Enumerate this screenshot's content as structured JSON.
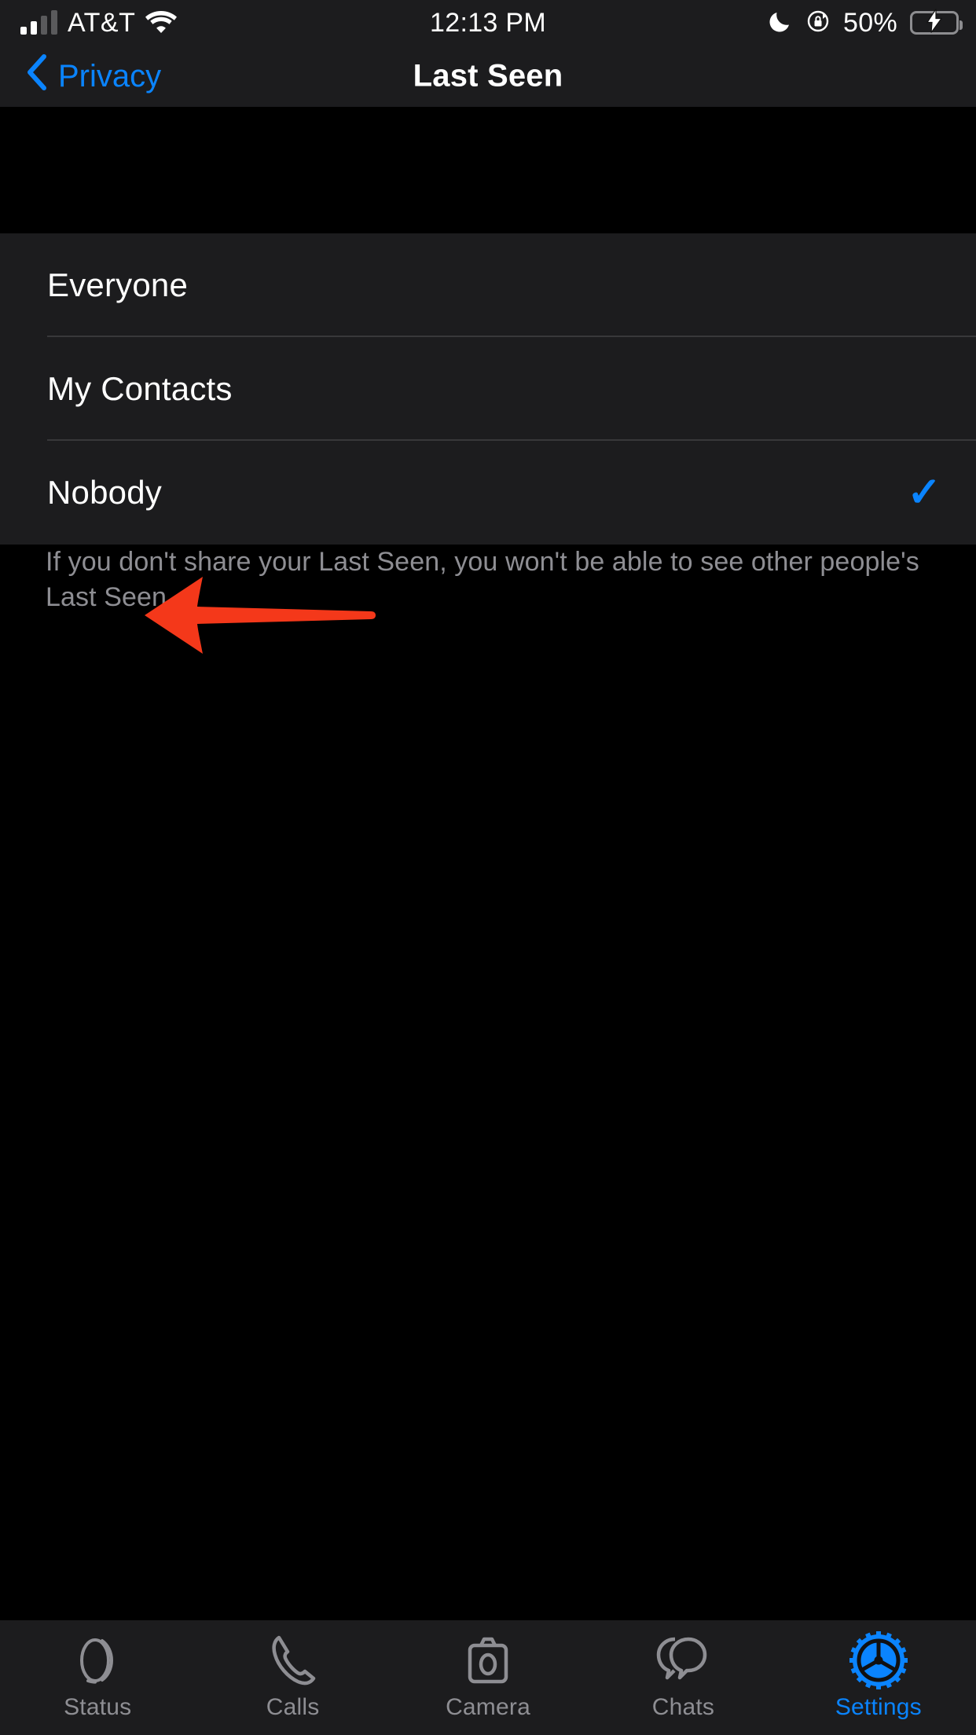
{
  "status_bar": {
    "carrier": "AT&T",
    "signal_bars_filled": 2,
    "signal_bars_total": 4,
    "wifi": "wifi-icon",
    "time": "12:13 PM",
    "dnd": "moon-icon",
    "rotation_lock": "rotation-lock-icon",
    "battery_percent": "50%",
    "battery_level": 50,
    "charging": true,
    "battery_color": "#2fd158"
  },
  "nav": {
    "back_label": "Privacy",
    "title": "Last Seen",
    "accent": "#0a84ff"
  },
  "options": [
    {
      "label": "Everyone",
      "selected": false
    },
    {
      "label": "My Contacts",
      "selected": false
    },
    {
      "label": "Nobody",
      "selected": true,
      "check": "✓"
    }
  ],
  "footer_text": "If you don't share your Last Seen, you won't be able to see other people's Last Seen.",
  "annotation": {
    "shape": "left-arrow",
    "color": "#f4381a"
  },
  "tabs": [
    {
      "label": "Status",
      "icon": "status-rings-icon",
      "active": false
    },
    {
      "label": "Calls",
      "icon": "phone-icon",
      "active": false
    },
    {
      "label": "Camera",
      "icon": "camera-icon",
      "active": false
    },
    {
      "label": "Chats",
      "icon": "chat-bubbles-icon",
      "active": false
    },
    {
      "label": "Settings",
      "icon": "gear-icon",
      "active": true
    }
  ]
}
